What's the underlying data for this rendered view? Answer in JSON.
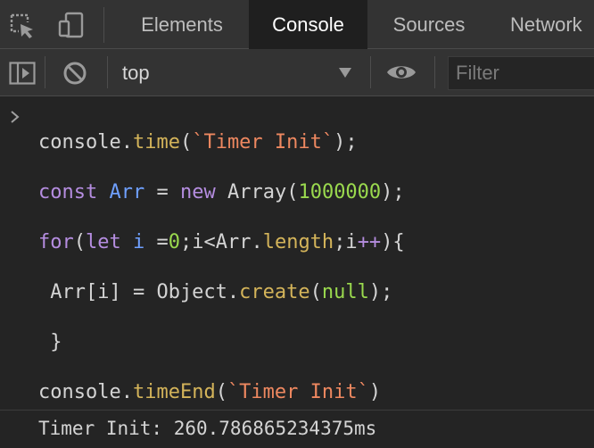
{
  "tabs": {
    "elements": "Elements",
    "console": "Console",
    "sources": "Sources",
    "network": "Network",
    "active": "Console"
  },
  "icons": {
    "select": "select-element-icon",
    "device": "device-toolbar-icon",
    "sidebar": "sidebar-toggle-icon",
    "clear": "clear-console-icon",
    "context_arrow": "dropdown-arrow-icon",
    "eye": "live-expression-eye-icon",
    "prompt": "prompt-chevron-icon"
  },
  "toolbar": {
    "context": "top",
    "filter_placeholder": "Filter"
  },
  "code_lines": [
    {
      "tokens": [
        {
          "t": "console.",
          "c": ""
        },
        {
          "t": "time",
          "c": "fn"
        },
        {
          "t": "(",
          "c": ""
        },
        {
          "t": "`Timer Init`",
          "c": "str"
        },
        {
          "t": ");",
          "c": ""
        }
      ]
    },
    {
      "tokens": [
        {
          "t": "const ",
          "c": "kw"
        },
        {
          "t": "Arr",
          "c": "id"
        },
        {
          "t": " = ",
          "c": ""
        },
        {
          "t": "new ",
          "c": "kw"
        },
        {
          "t": "Array(",
          "c": ""
        },
        {
          "t": "1000000",
          "c": "num"
        },
        {
          "t": ");",
          "c": ""
        }
      ]
    },
    {
      "tokens": [
        {
          "t": "for",
          "c": "kw"
        },
        {
          "t": "(",
          "c": ""
        },
        {
          "t": "let ",
          "c": "kw"
        },
        {
          "t": "i",
          "c": "id"
        },
        {
          "t": " =",
          "c": ""
        },
        {
          "t": "0",
          "c": "num"
        },
        {
          "t": ";i<Arr.",
          "c": ""
        },
        {
          "t": "length",
          "c": "fn"
        },
        {
          "t": ";i",
          "c": ""
        },
        {
          "t": "++",
          "c": "op"
        },
        {
          "t": "){",
          "c": ""
        }
      ]
    },
    {
      "tokens": [
        {
          "t": " Arr[i] = Object.",
          "c": ""
        },
        {
          "t": "create",
          "c": "fn"
        },
        {
          "t": "(",
          "c": ""
        },
        {
          "t": "null",
          "c": "num"
        },
        {
          "t": ");",
          "c": ""
        }
      ]
    },
    {
      "tokens": [
        {
          "t": " }",
          "c": ""
        }
      ]
    },
    {
      "tokens": [
        {
          "t": "console.",
          "c": ""
        },
        {
          "t": "timeEnd",
          "c": "fn"
        },
        {
          "t": "(",
          "c": ""
        },
        {
          "t": "`Timer Init`",
          "c": "str"
        },
        {
          "t": ")",
          "c": ""
        }
      ]
    }
  ],
  "output": "Timer Init: 260.786865234375ms",
  "colors": {
    "keyword": "#b58de0",
    "function": "#d4b45a",
    "string": "#ee8860",
    "number": "#9ad94e",
    "identifier": "#6fa0ff"
  }
}
